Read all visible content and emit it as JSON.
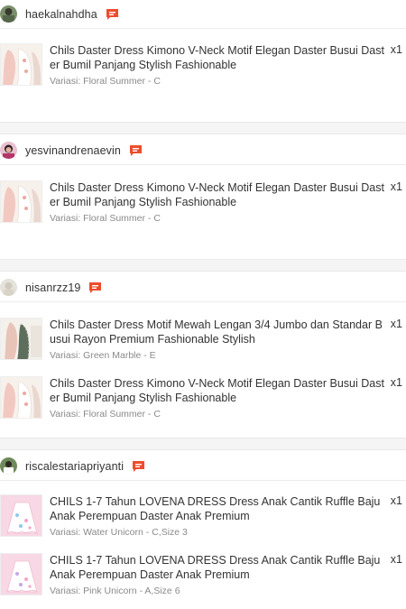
{
  "orders": [
    {
      "username": "haekalnahdha",
      "products": [
        {
          "name": "Chils Daster Dress Kimono V-Neck Motif Elegan Daster Busui Daster Bumil Panjang Stylish Fashionable",
          "qty": "x1",
          "variant": "Variasi: Floral Summer - C"
        }
      ]
    },
    {
      "username": "yesvinandrenaevin",
      "products": [
        {
          "name": "Chils Daster Dress Kimono V-Neck Motif Elegan Daster Busui Daster Bumil Panjang Stylish Fashionable",
          "qty": "x1",
          "variant": "Variasi: Floral Summer - C"
        }
      ]
    },
    {
      "username": "nisanrzz19",
      "products": [
        {
          "name": "Chils Daster Dress Motif Mewah Lengan 3/4 Jumbo dan Standar Busui Rayon Premium Fashionable Stylish",
          "qty": "x1",
          "variant": "Variasi: Green Marble - E"
        },
        {
          "name": "Chils Daster Dress Kimono V-Neck Motif Elegan Daster Busui Daster Bumil Panjang Stylish Fashionable",
          "qty": "x1",
          "variant": "Variasi: Floral Summer - C"
        }
      ]
    },
    {
      "username": "riscalestariapriyanti",
      "products": [
        {
          "name": "CHILS 1-7 Tahun LOVENA DRESS Dress Anak Cantik Ruffle Baju Anak Perempuan Daster Anak Premium",
          "qty": "x1",
          "variant": "Variasi: Water Unicorn - C,Size 3"
        },
        {
          "name": "CHILS 1-7 Tahun LOVENA DRESS Dress Anak Cantik Ruffle Baju Anak Perempuan Daster Anak Premium",
          "qty": "x1",
          "variant": "Variasi: Pink Unicorn - A,Size 6"
        }
      ]
    }
  ],
  "icons": {
    "chat": "chat-bubble-icon"
  },
  "colors": {
    "chat_icon": "#ee4d2d",
    "separator": "#f5f5f5",
    "variant_text": "#8a8a8a"
  }
}
